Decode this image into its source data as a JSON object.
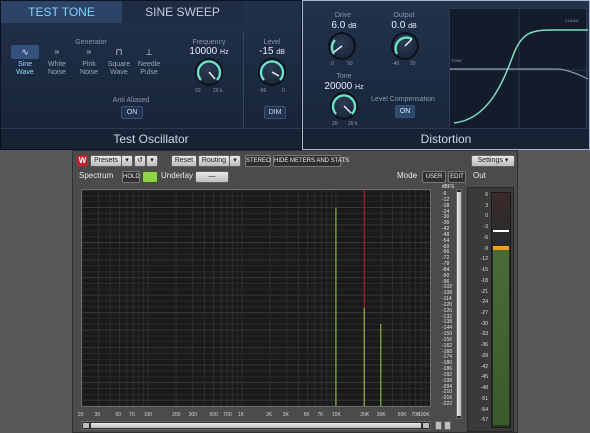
{
  "oscillator": {
    "tabs": [
      "TEST TONE",
      "SINE SWEEP"
    ],
    "generator_label": "Generator",
    "waveforms": [
      {
        "label": "Sine\nWave",
        "glyph": "∿"
      },
      {
        "label": "White\nNoise",
        "glyph": "≈"
      },
      {
        "label": "Pink\nNoise",
        "glyph": "≈"
      },
      {
        "label": "Square\nWave",
        "glyph": "⊓"
      },
      {
        "label": "Needle\nPulse",
        "glyph": "⊥"
      }
    ],
    "frequency": {
      "label": "Frequency",
      "value": "10000",
      "unit": "Hz",
      "min": "20",
      "max": "20 k"
    },
    "level": {
      "label": "Level",
      "value": "-15",
      "unit": "dB",
      "min": "-96",
      "max": "0"
    },
    "anti_aliased": {
      "label": "Anti Aliased",
      "button": "ON"
    },
    "dim_button": "DIM",
    "title": "Test Oscillator"
  },
  "distortion": {
    "drive": {
      "label": "Drive",
      "value": "6.0",
      "unit": "dB",
      "min": "0",
      "max": "50"
    },
    "output": {
      "label": "Output",
      "value": "0.0",
      "unit": "dB",
      "min": "-40",
      "max": "20"
    },
    "tone": {
      "label": "Tone",
      "value": "20000",
      "unit": "Hz",
      "min": "20",
      "max": "20 k"
    },
    "level_comp": {
      "label": "Level Compensation",
      "button": "ON"
    },
    "curve_labels": {
      "top": "CLEAN",
      "mid": "TONE"
    },
    "title": "Distortion"
  },
  "analyzer": {
    "presets": "Presets",
    "reset": "Reset",
    "routing": "Routing",
    "stereo": "STEREO",
    "hide_meters": "HIDE METERS AND STATS",
    "settings": "Settings",
    "spectrum_label": "Spectrum",
    "hold": "HOLD",
    "underlay_label": "Underlay",
    "underlay_value": "—",
    "mode_label": "Mode",
    "user": "USER",
    "edit": "EDIT",
    "out_label": "Out",
    "accent": "#8ed24a",
    "freq_ticks": [
      "20",
      "30",
      "50",
      "70",
      "100",
      "200",
      "300",
      "500",
      "700",
      "1K",
      "2K",
      "3K",
      "5K",
      "7K",
      "10K",
      "20K",
      "30K",
      "50K",
      "70K",
      "100K"
    ],
    "db_ticks": [
      "-6",
      "-12",
      "-18",
      "-24",
      "-30",
      "-36",
      "-42",
      "-48",
      "-54",
      "-60",
      "-66",
      "-72",
      "-78",
      "-84",
      "-90",
      "-96",
      "-102",
      "-108",
      "-114",
      "-120",
      "-126",
      "-132",
      "-138",
      "-144",
      "-150",
      "-156",
      "-162",
      "-168",
      "-174",
      "-180",
      "-186",
      "-192",
      "-198",
      "-204",
      "-210",
      "-216",
      "-222"
    ],
    "dbfs_label": "dBFS",
    "out_ticks": [
      "6",
      "3",
      "0",
      "-3",
      "-6",
      "-9",
      "-12",
      "-15",
      "-18",
      "-21",
      "-24",
      "-27",
      "-30",
      "-33",
      "-36",
      "-39",
      "-42",
      "-45",
      "-48",
      "-51",
      "-54",
      "-57"
    ],
    "peak_hold": "-15",
    "rms_value": "-18"
  }
}
